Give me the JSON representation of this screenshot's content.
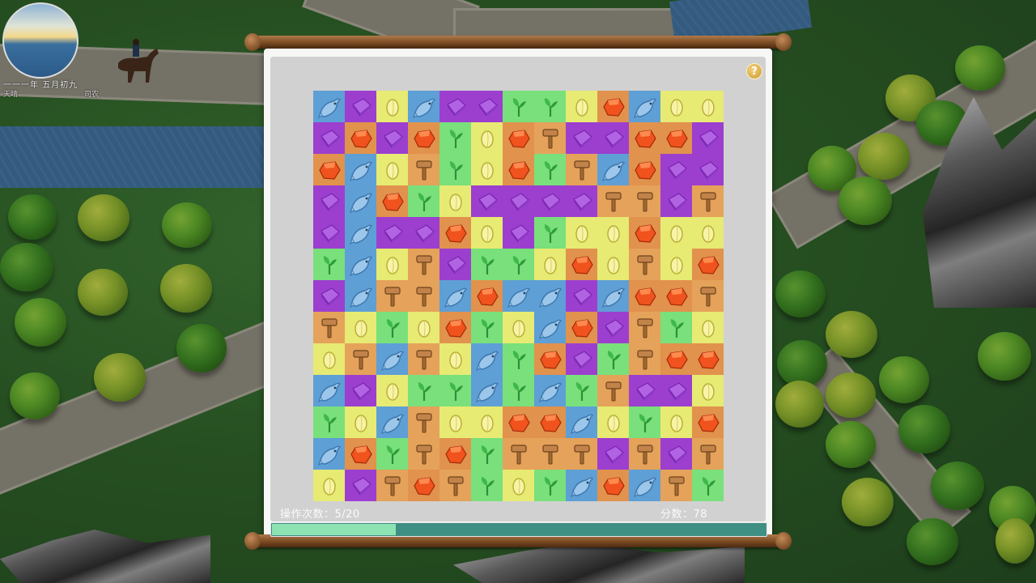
{
  "hud": {
    "date": "一一一年 五月初九",
    "sub_left": "天晴",
    "sub_right": "司农"
  },
  "panel": {
    "moves_label": "操作次数：5/20",
    "score_label": "分数：78",
    "progress": 0.25
  },
  "tile_types": {
    "F": {
      "name": "fish",
      "color": "#5e9fd6",
      "icon": "fish-icon"
    },
    "P": {
      "name": "purple-crystal",
      "color": "#9c3fcf",
      "icon": "purple-crystal-icon"
    },
    "Y": {
      "name": "yellow-seed",
      "color": "#e7ea73",
      "icon": "seed-icon"
    },
    "O": {
      "name": "orange-gem",
      "color": "#e1924d",
      "icon": "orange-gem-icon"
    },
    "G": {
      "name": "sprout",
      "color": "#79e07b",
      "icon": "sprout-icon"
    },
    "H": {
      "name": "hammer",
      "color": "#e5a25a",
      "icon": "hammer-icon"
    }
  },
  "board": [
    [
      "F",
      "P",
      "Y",
      "F",
      "P",
      "P",
      "G",
      "G",
      "Y",
      "O",
      "F",
      "Y",
      "Y"
    ],
    [
      "P",
      "O",
      "P",
      "O",
      "G",
      "Y",
      "O",
      "H",
      "P",
      "P",
      "O",
      "O",
      "P"
    ],
    [
      "O",
      "F",
      "Y",
      "H",
      "G",
      "Y",
      "O",
      "G",
      "H",
      "F",
      "O",
      "P",
      "P"
    ],
    [
      "P",
      "F",
      "O",
      "G",
      "Y",
      "P",
      "P",
      "P",
      "P",
      "H",
      "H",
      "P",
      "H"
    ],
    [
      "P",
      "F",
      "P",
      "P",
      "O",
      "Y",
      "P",
      "G",
      "Y",
      "Y",
      "O",
      "Y",
      "Y"
    ],
    [
      "G",
      "F",
      "Y",
      "H",
      "P",
      "G",
      "G",
      "Y",
      "O",
      "Y",
      "H",
      "Y",
      "O"
    ],
    [
      "P",
      "F",
      "H",
      "H",
      "F",
      "O",
      "F",
      "F",
      "P",
      "F",
      "O",
      "O",
      "H"
    ],
    [
      "H",
      "Y",
      "G",
      "Y",
      "O",
      "G",
      "Y",
      "F",
      "O",
      "P",
      "H",
      "G",
      "Y"
    ],
    [
      "Y",
      "H",
      "F",
      "H",
      "Y",
      "F",
      "G",
      "O",
      "P",
      "G",
      "H",
      "O",
      "O"
    ],
    [
      "F",
      "P",
      "Y",
      "G",
      "G",
      "F",
      "G",
      "F",
      "G",
      "H",
      "P",
      "P",
      "Y"
    ],
    [
      "G",
      "Y",
      "F",
      "H",
      "Y",
      "Y",
      "O",
      "O",
      "F",
      "Y",
      "G",
      "Y",
      "O"
    ],
    [
      "F",
      "O",
      "G",
      "H",
      "O",
      "G",
      "H",
      "H",
      "H",
      "P",
      "H",
      "P",
      "H"
    ],
    [
      "Y",
      "P",
      "H",
      "O",
      "H",
      "G",
      "Y",
      "G",
      "F",
      "O",
      "F",
      "H",
      "G"
    ]
  ]
}
